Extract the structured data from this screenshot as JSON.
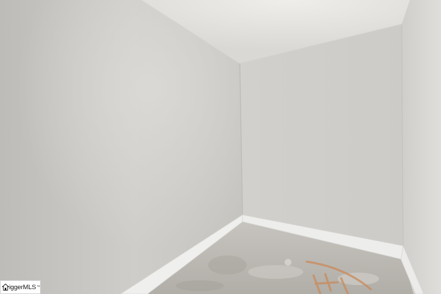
{
  "image": {
    "subject": "empty-room-corner",
    "colors": {
      "left_wall": "#c9c7c3",
      "back_wall": "#d3d1cd",
      "right_wall": "#dcdad6",
      "ceiling": "#e4e2de",
      "baseboard": "#eeeeec",
      "floor": "#bdbab4",
      "floor_marking": "#c98a5a"
    }
  },
  "watermark": {
    "text": "iggerMLS",
    "trademark": "™",
    "icon": "house-icon"
  }
}
